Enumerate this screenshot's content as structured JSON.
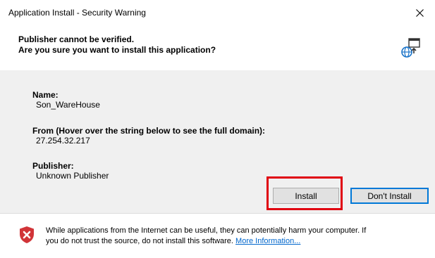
{
  "window": {
    "title": "Application Install - Security Warning",
    "close_icon": "close-icon"
  },
  "header": {
    "line1": "Publisher cannot be verified.",
    "line2": "Are you sure you want to install this application?",
    "icon": "globe-install-icon"
  },
  "details": {
    "name_label": "Name:",
    "name_value": "Son_WareHouse",
    "from_label": "From (Hover over the string below to see the full domain):",
    "from_value": "27.254.32.217",
    "publisher_label": "Publisher:",
    "publisher_value": "Unknown Publisher"
  },
  "buttons": {
    "install_label": "Install",
    "dont_install_label": "Don't Install"
  },
  "footer": {
    "icon": "shield-warning-icon",
    "text_line1": "While applications from the Internet can be useful, they can potentially harm your computer. If",
    "text_line2": "you do not trust the source, do not install this software.",
    "link_text": "More Information..."
  },
  "colors": {
    "highlight": "#e0000f",
    "accent": "#0078d7",
    "shield": "#d13438",
    "link": "#0066cc"
  }
}
